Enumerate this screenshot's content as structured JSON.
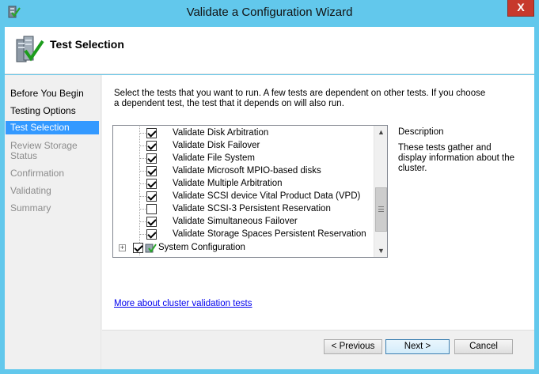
{
  "window": {
    "title": "Validate a Configuration Wizard",
    "close_glyph": "X"
  },
  "header": {
    "title": "Test Selection",
    "icon": "cluster-validate-icon"
  },
  "nav": {
    "items": [
      {
        "label": "Before You Begin",
        "state": "normal"
      },
      {
        "label": "Testing Options",
        "state": "normal"
      },
      {
        "label": "Test Selection",
        "state": "selected"
      },
      {
        "label": "Review Storage Status",
        "state": "disabled"
      },
      {
        "label": "Confirmation",
        "state": "disabled"
      },
      {
        "label": "Validating",
        "state": "disabled"
      },
      {
        "label": "Summary",
        "state": "disabled"
      }
    ]
  },
  "main": {
    "instructions": "Select the tests that you want to run.  A few tests are dependent on other tests.  If you choose a dependent test, the test that it depends on will also run.",
    "tests": [
      {
        "label": "Validate Disk Arbitration",
        "checked": true
      },
      {
        "label": "Validate Disk Failover",
        "checked": true
      },
      {
        "label": "Validate File System",
        "checked": true
      },
      {
        "label": "Validate Microsoft MPIO-based disks",
        "checked": true
      },
      {
        "label": "Validate Multiple Arbitration",
        "checked": true
      },
      {
        "label": "Validate SCSI device Vital Product Data (VPD)",
        "checked": true
      },
      {
        "label": "Validate SCSI-3 Persistent Reservation",
        "checked": false
      },
      {
        "label": "Validate Simultaneous Failover",
        "checked": true
      },
      {
        "label": "Validate Storage Spaces Persistent Reservation",
        "checked": true
      }
    ],
    "system_config": {
      "label": "System Configuration",
      "checked": true,
      "expander": "+"
    },
    "description_title": "Description",
    "description_text": "These tests gather and display information about the cluster.",
    "more_link": "More about cluster validation tests"
  },
  "scrollbar": {
    "up_glyph": "▲",
    "down_glyph": "▼"
  },
  "footer": {
    "previous": "< Previous",
    "next": "Next >",
    "cancel": "Cancel"
  },
  "colors": {
    "frame": "#62c8ec",
    "selection": "#3399ff",
    "close": "#c7392c"
  }
}
